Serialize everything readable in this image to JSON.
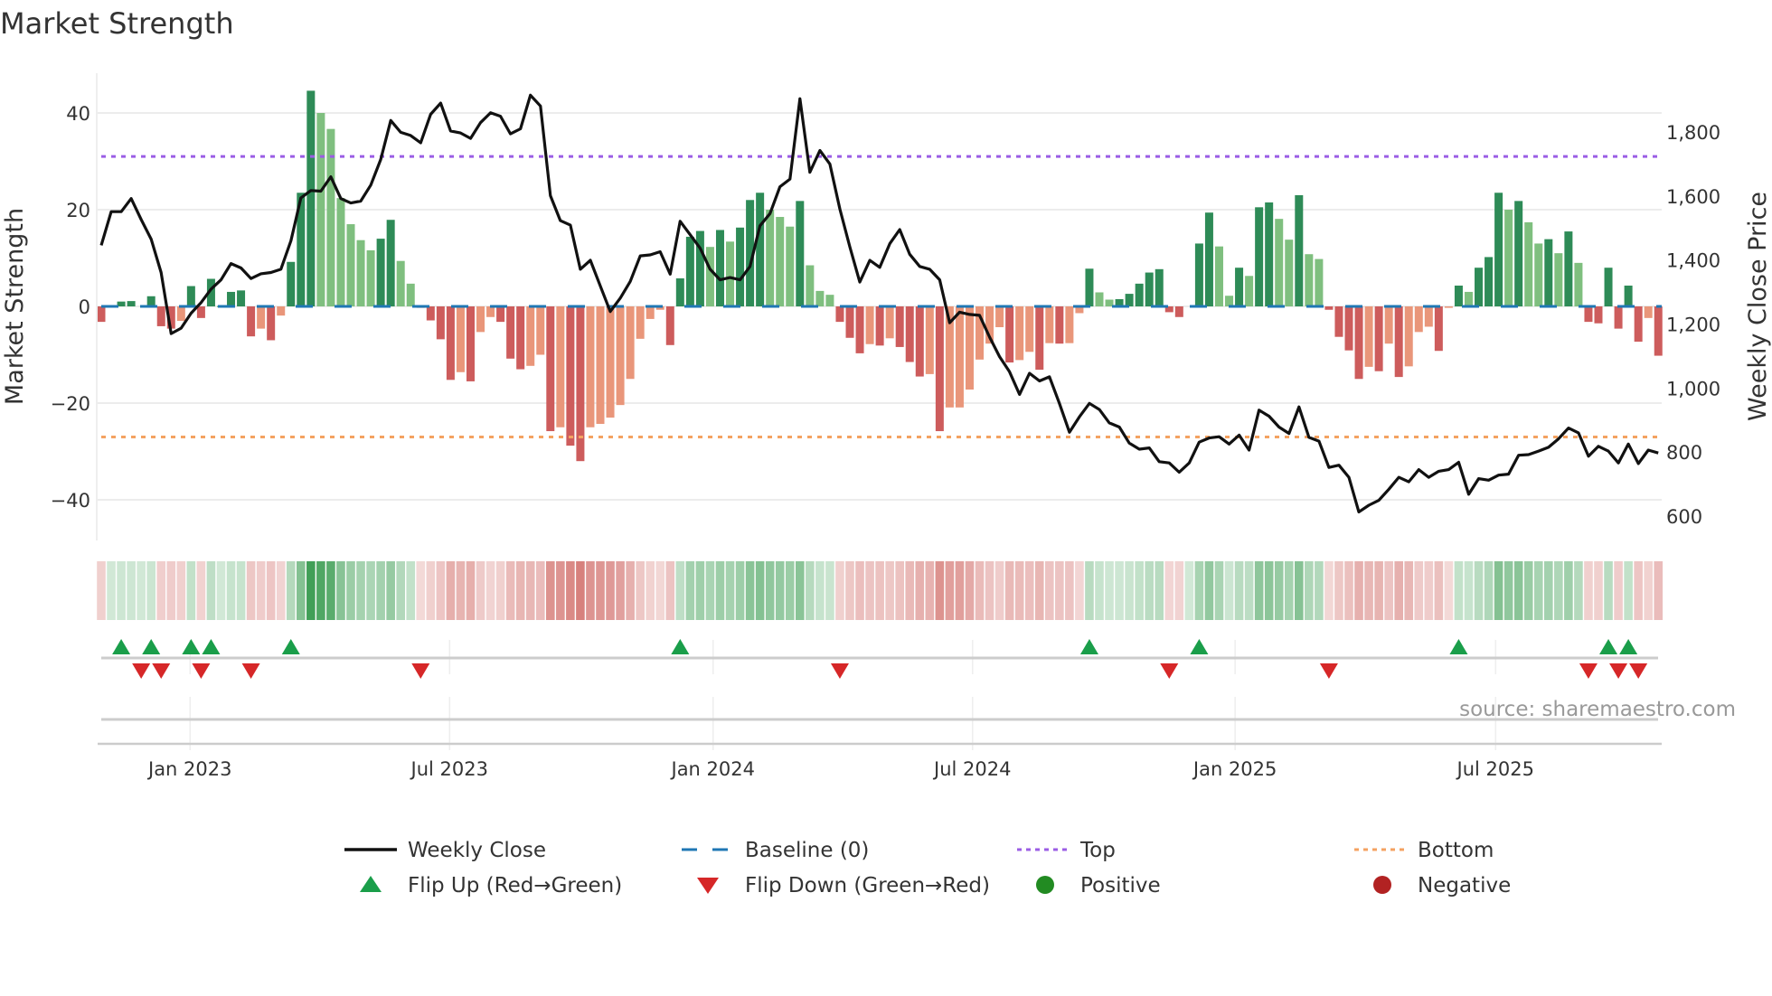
{
  "chart_data": {
    "type": "bar",
    "title": "Market Strength",
    "ylabel": "Market Strength",
    "y2label": "Weekly Close Price",
    "ylim": [
      -48,
      48
    ],
    "y2lim": [
      526,
      1983
    ],
    "yticks": [
      {
        "value": 40,
        "label": "40"
      },
      {
        "value": 20,
        "label": "20"
      },
      {
        "value": 0,
        "label": "0"
      },
      {
        "value": -20,
        "label": "−20"
      },
      {
        "value": -40,
        "label": "−40"
      }
    ],
    "y2ticks": [
      {
        "value": 1800,
        "label": "1,800"
      },
      {
        "value": 1600,
        "label": "1,600"
      },
      {
        "value": 1400,
        "label": "1,400"
      },
      {
        "value": 1200,
        "label": "1,200"
      },
      {
        "value": 1000,
        "label": "1,000"
      },
      {
        "value": 800,
        "label": "800"
      },
      {
        "value": 600,
        "label": "600"
      }
    ],
    "xticks": [
      {
        "week": 8.9,
        "label": "Jan 2023"
      },
      {
        "week": 34.9,
        "label": "Jul 2023"
      },
      {
        "week": 61.3,
        "label": "Jan 2024"
      },
      {
        "week": 87.3,
        "label": "Jul 2024"
      },
      {
        "week": 113.6,
        "label": "Jan 2025"
      },
      {
        "week": 139.7,
        "label": "Jul 2025"
      }
    ],
    "top_level": 31,
    "bottom_level": -27,
    "baseline": 0,
    "strength": [
      -3.2,
      0,
      1,
      1.1,
      0,
      2.1,
      -4.1,
      -4.6,
      -3,
      4.2,
      -2.4,
      5.7,
      0.1,
      3,
      3.3,
      -6.2,
      -4.6,
      -7,
      -1.9,
      9.2,
      23.5,
      44.6,
      40,
      36.7,
      22.4,
      17,
      13.7,
      11.6,
      14,
      17.9,
      9.4,
      4.7,
      -0.3,
      -2.9,
      -6.8,
      -15.2,
      -13.6,
      -15.5,
      -5.3,
      -2.2,
      -3.2,
      -10.8,
      -13,
      -12.3,
      -10,
      -25.8,
      -25,
      -28.8,
      -32,
      -25,
      -24.3,
      -23,
      -20.4,
      -15,
      -6.7,
      -2.6,
      -0.7,
      -8,
      5.8,
      14.4,
      15.6,
      12.3,
      15.8,
      13.4,
      16.3,
      22,
      23.5,
      20,
      18.5,
      16.5,
      21.8,
      8.5,
      3.2,
      2.4,
      -3.2,
      -6.5,
      -9.7,
      -7.8,
      -8.1,
      -6.6,
      -8.4,
      -11.5,
      -14.5,
      -14,
      -25.8,
      -20.9,
      -20.9,
      -17.2,
      -11,
      -7.7,
      -4.3,
      -11.6,
      -11.1,
      -9.4,
      -13.1,
      -7.6,
      -7.7,
      -7.6,
      -1.4,
      7.8,
      2.9,
      1.4,
      1.5,
      2.6,
      4.7,
      7,
      7.7,
      -1.2,
      -2.2,
      0,
      13,
      19.4,
      12.4,
      2.2,
      8,
      6.3,
      20.5,
      21.5,
      18.1,
      13.8,
      23,
      10.8,
      9.8,
      -0.7,
      -6.3,
      -9.1,
      -15,
      -12.5,
      -13.4,
      -7.7,
      -14.6,
      -12.4,
      -5.3,
      -4.2,
      -9.2,
      -0.3,
      4.3,
      3,
      8,
      10.2,
      23.5,
      20,
      21.8,
      17.4,
      13,
      13.9,
      11,
      15.5,
      9,
      -3.2,
      -3.5,
      8,
      -4.6,
      4.3,
      -7.3,
      -2.4,
      -10.2
    ],
    "weekly_close": [
      1446,
      1551,
      1551,
      1592,
      1526,
      1465,
      1361,
      1170,
      1187,
      1234,
      1267,
      1309,
      1338,
      1389,
      1375,
      1342,
      1357,
      1361,
      1371,
      1460,
      1594,
      1617,
      1615,
      1660,
      1592,
      1578,
      1584,
      1634,
      1714,
      1836,
      1799,
      1789,
      1766,
      1855,
      1890,
      1803,
      1797,
      1780,
      1829,
      1860,
      1849,
      1794,
      1810,
      1915,
      1881,
      1601,
      1523,
      1509,
      1371,
      1399,
      1319,
      1239,
      1281,
      1333,
      1413,
      1416,
      1426,
      1356,
      1521,
      1479,
      1437,
      1371,
      1338,
      1345,
      1338,
      1380,
      1507,
      1545,
      1629,
      1653,
      1904,
      1674,
      1742,
      1700,
      1559,
      1441,
      1331,
      1399,
      1377,
      1451,
      1495,
      1418,
      1380,
      1371,
      1338,
      1204,
      1237,
      1230,
      1227,
      1159,
      1098,
      1051,
      980,
      1046,
      1022,
      1035,
      952,
      862,
      910,
      952,
      933,
      891,
      878,
      828,
      809,
      813,
      770,
      766,
      737,
      766,
      831,
      844,
      848,
      825,
      853,
      806,
      931,
      912,
      878,
      858,
      941,
      846,
      834,
      752,
      759,
      721,
      613,
      634,
      649,
      684,
      721,
      707,
      745,
      721,
      740,
      745,
      768,
      668,
      717,
      712,
      728,
      731,
      790,
      792,
      803,
      815,
      841,
      875,
      860,
      787,
      818,
      803,
      766,
      825,
      764,
      806,
      797
    ],
    "flip_up_weeks": [
      2,
      5,
      9,
      11,
      19,
      58,
      99,
      110,
      136,
      151,
      153
    ],
    "flip_down_weeks": [
      4,
      6,
      10,
      15,
      32,
      74,
      107,
      123,
      149,
      152,
      154
    ],
    "legend": {
      "weekly_close": "Weekly Close",
      "baseline": "Baseline (0)",
      "top": "Top",
      "bottom": "Bottom",
      "flip_up": "Flip Up (Red→Green)",
      "flip_down": "Flip Down (Green→Red)",
      "positive": "Positive",
      "negative": "Negative"
    },
    "source": "source: sharemaestro.com",
    "colors": {
      "pos_strong": "#2e8b57",
      "pos_weak": "#7fbf7f",
      "neg_strong": "#cd5c5c",
      "neg_weak": "#e9967a",
      "top": "#9b5de5",
      "bottom": "#f4a261",
      "baseline": "#1f77b4",
      "close": "#111111",
      "flip_up": "#1a9e4a",
      "flip_down": "#d62728",
      "positive": "#228b22",
      "negative": "#b22222"
    }
  }
}
